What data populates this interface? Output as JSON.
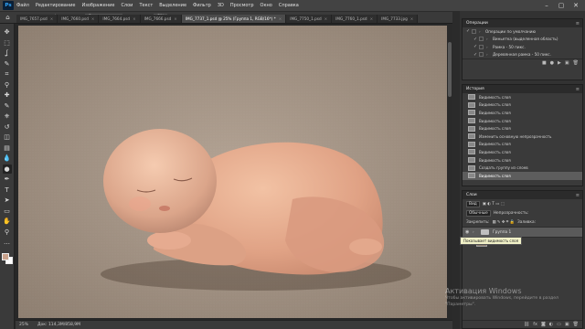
{
  "app": {
    "logo": "Ps"
  },
  "menu": [
    "Файл",
    "Редактирование",
    "Изображение",
    "Слои",
    "Текст",
    "Выделение",
    "Фильтр",
    "3D",
    "Просмотр",
    "Окно",
    "Справка"
  ],
  "window_controls": {
    "minimize": "–",
    "maximize": "▢",
    "close": "✕"
  },
  "options": {
    "mode_label": "Диапазон:",
    "mode_value": "Средние тона",
    "exposure_label": "Экспонир.:",
    "exposure_value": "5%",
    "protect_label": "Защитить тона"
  },
  "tabs": [
    {
      "label": "IMG_7657.psd",
      "active": false
    },
    {
      "label": "IMG_7660.psd",
      "active": false
    },
    {
      "label": "IMG_7664.psd",
      "active": false
    },
    {
      "label": "IMG_7666.psd",
      "active": false
    },
    {
      "label": "IMG_7737_1.psd @ 25% (Группа 1, RGB/16*) *",
      "active": true
    },
    {
      "label": "IMG_7750_1.psd",
      "active": false
    },
    {
      "label": "IMG_7760_1.psd",
      "active": false
    },
    {
      "label": "IMG_7733.jpg",
      "active": false
    }
  ],
  "tools": [
    "move-icon",
    "marquee-icon",
    "lasso-icon",
    "quick-select-icon",
    "crop-icon",
    "eyedropper-icon",
    "healing-icon",
    "brush-icon",
    "stamp-icon",
    "history-brush-icon",
    "eraser-icon",
    "gradient-icon",
    "blur-icon",
    "dodge-icon",
    "pen-icon",
    "type-icon",
    "path-select-icon",
    "shape-icon",
    "hand-icon",
    "zoom-icon",
    "more-icon"
  ],
  "tool_glyphs": [
    "✥",
    "⬚",
    "ʆ",
    "✎",
    "⌗",
    "⚲",
    "✚",
    "✎",
    "⎈",
    "↺",
    "◫",
    "▤",
    "💧",
    "●",
    "✒",
    "T",
    "➤",
    "▭",
    "✋",
    "⚲",
    "…"
  ],
  "colors": {
    "foreground": "#c9a28c",
    "background": "#ffffff"
  },
  "status": {
    "zoom": "25%",
    "doc": "Док: 114,3M/858,9M"
  },
  "actions_panel": {
    "title": "Операции",
    "rows": [
      {
        "label": "Операции по умолчанию",
        "checked": true
      },
      {
        "label": "Виньетка (выделенная область)",
        "checked": true
      },
      {
        "label": "Рамка - 50 пикс.",
        "checked": true
      },
      {
        "label": "Деревянная рамка - 50 пикс.",
        "checked": true
      }
    ]
  },
  "history_panel": {
    "title": "История",
    "rows": [
      "Видимость слоя",
      "Видимость слоя",
      "Видимость слоя",
      "Видимость слоя",
      "Видимость слоя",
      "Изменить основную непрозрачность",
      "Видимость слоя",
      "Видимость слоя",
      "Видимость слоя",
      "Создать группу из слоев",
      "Видимость слоя"
    ],
    "active_index": 10
  },
  "layers_panel": {
    "title": "Слои",
    "kind_filter": "Вид",
    "blend_mode": "Обычные",
    "opacity_label": "Непрозрачность:",
    "lock_label": "Закрепить:",
    "fill_label": "Заливка:",
    "layers": [
      {
        "name": "Группа 1",
        "type": "group",
        "active": true
      },
      {
        "name": "Фон",
        "type": "image",
        "active": false
      }
    ],
    "tooltip": "Показывает видимость слоя"
  },
  "watermark": {
    "title": "Активация Windows",
    "line1": "Чтобы активировать Windows, перейдите в раздел",
    "line2": "\"Параметры\"."
  }
}
